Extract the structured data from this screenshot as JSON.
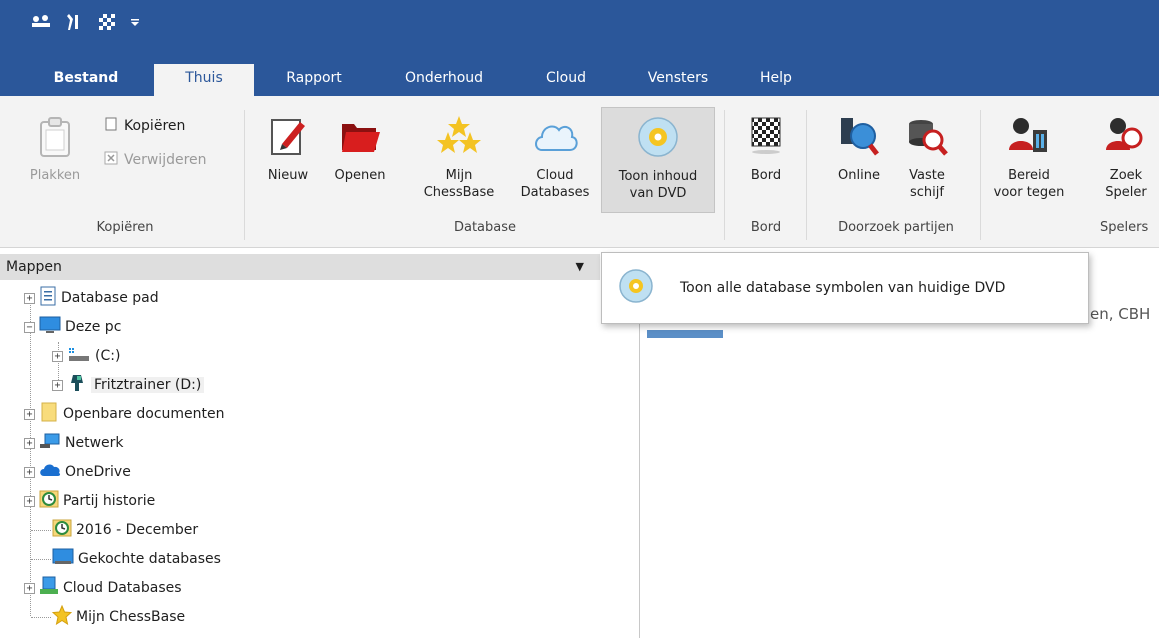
{
  "quick_access": [
    "chess-pieces-icon",
    "tools-icon",
    "board-icon",
    "dropdown-arrow-icon"
  ],
  "tabs": [
    "Bestand",
    "Thuis",
    "Rapport",
    "Onderhoud",
    "Cloud",
    "Vensters",
    "Help"
  ],
  "active_tab": "Thuis",
  "ribbon": {
    "kopieren_group": {
      "label": "Kopiëren",
      "plakken": "Plakken",
      "kopieren": "Kopiëren",
      "verwijderen": "Verwijderen"
    },
    "database_group": {
      "label": "Database",
      "nieuw": "Nieuw",
      "openen": "Openen",
      "mijn_line1": "Mijn",
      "mijn_line2": "ChessBase",
      "cloud_line1": "Cloud",
      "cloud_line2": "Databases",
      "toon_line1": "Toon inhoud",
      "toon_line2": "van DVD"
    },
    "bord_group": {
      "label": "Bord",
      "bord": "Bord"
    },
    "doorzoek_group": {
      "label": "Doorzoek partijen",
      "online": "Online",
      "vaste_line1": "Vaste",
      "vaste_line2": "schijf"
    },
    "spelers_group": {
      "label": "Spelers",
      "bereid_line1": "Bereid",
      "bereid_line2": "voor tegen",
      "zoek_line1": "Zoek",
      "zoek_line2": "Speler"
    }
  },
  "panel": {
    "title": "Mappen"
  },
  "tree": [
    {
      "label": "Database pad",
      "icon": "document-icon"
    },
    {
      "label": "Deze pc",
      "icon": "monitor-icon"
    },
    {
      "label": "(C:)",
      "icon": "drive-icon"
    },
    {
      "label": "Fritztrainer (D:)",
      "icon": "dvd-drive-icon"
    },
    {
      "label": "Openbare documenten",
      "icon": "folder-icon"
    },
    {
      "label": "Netwerk",
      "icon": "network-icon"
    },
    {
      "label": "OneDrive",
      "icon": "cloud-icon"
    },
    {
      "label": "Partij historie",
      "icon": "history-icon"
    },
    {
      "label": "2016 - December",
      "icon": "history-icon"
    },
    {
      "label": "Gekochte databases",
      "icon": "monitor-icon"
    },
    {
      "label": "Cloud Databases",
      "icon": "cloud-database-icon"
    },
    {
      "label": "Mijn ChessBase",
      "icon": "star-icon"
    }
  ],
  "tooltip": {
    "text": "Toon alle database symbolen van huidige DVD"
  },
  "background_text": "en, CBH",
  "colors": {
    "accent": "#2b579a",
    "ribbon_bg": "#f3f3f3"
  }
}
